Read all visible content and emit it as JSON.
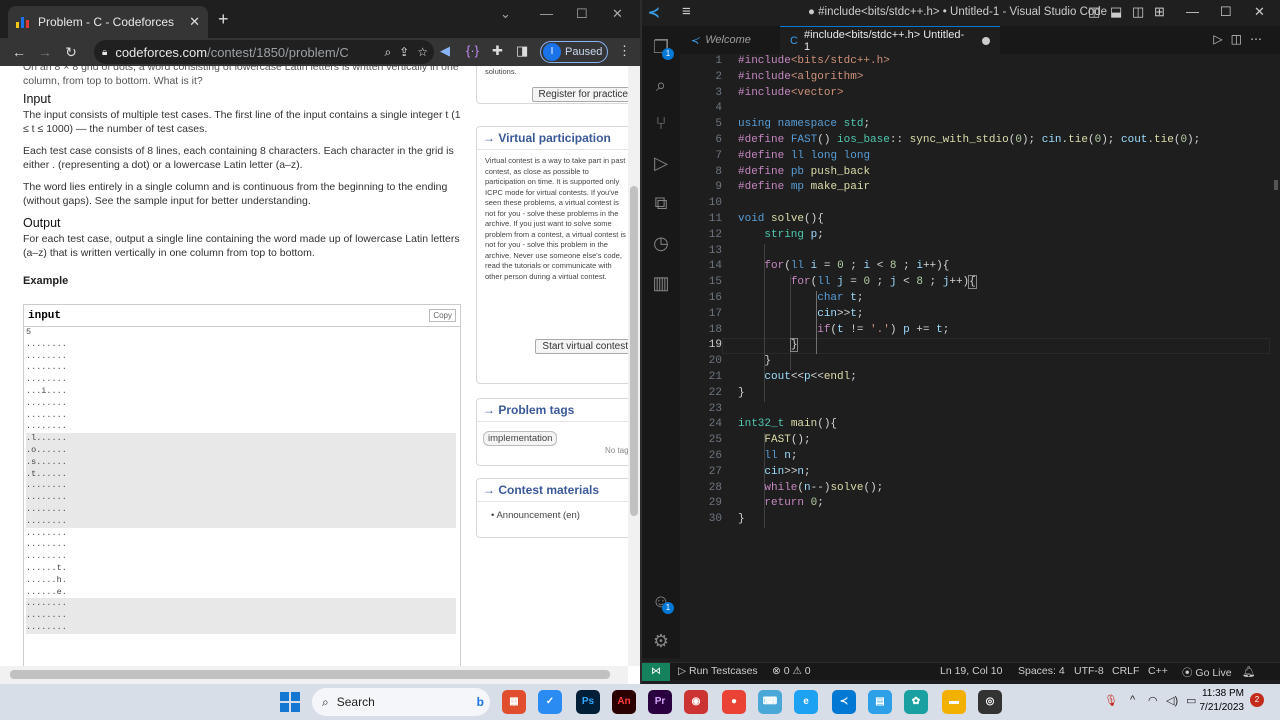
{
  "browser": {
    "tab_title": "Problem - C - Codeforces",
    "url_host": "codeforces.com",
    "url_path": "/contest/1850/problem/C",
    "profile_initial": "I",
    "profile_status": "Paused",
    "statement": {
      "intro_fragment": "On an 8 × 8 grid of dots, a word consisting of lowercase Latin letters is written vertically in one column, from top to bottom. What is it?",
      "input_heading": "Input",
      "input_p1": "The input consists of multiple test cases. The first line of the input contains a single integer t (1 ≤ t ≤ 1000) — the number of test cases.",
      "input_p2": "Each test case consists of 8 lines, each containing 8 characters. Each character in the grid is either . (representing a dot) or a lowercase Latin letter (a–z).",
      "input_p3": "The word lies entirely in a single column and is continuous from the beginning to the ending (without gaps). See the sample input for better understanding.",
      "output_heading": "Output",
      "output_p1": "For each test case, output a single line containing the word made up of lowercase Latin letters (a–z) that is written vertically in one column from top to bottom.",
      "example_label": "Example",
      "example_input_label": "input",
      "copy_label": "Copy"
    },
    "example_lines": [
      "5",
      "........",
      "........",
      "........",
      "........",
      "...i....",
      "........",
      "........",
      "........",
      ".l......",
      ".o......",
      ".s......",
      ".t......",
      "........",
      "........",
      "........",
      "........",
      "........",
      "........",
      "........",
      "......t.",
      "......h.",
      "......e.",
      "........",
      "........",
      "........"
    ],
    "sidebar": {
      "top_fragment": "solutions.",
      "register_button": "Register for practice",
      "virtual_title": "→ Virtual participation",
      "virtual_text": "Virtual contest is a way to take part in past contest, as close as possible to participation on time. It is supported only ICPC mode for virtual contests. If you've seen these problems, a virtual contest is not for you - solve these problems in the archive. If you just want to solve some problem from a contest, a virtual contest is not for you - solve this problem in the archive. Never use someone else's code, read the tutorials or communicate with other person during a virtual contest.",
      "virtual_button": "Start virtual contest",
      "tags_title": "→ Problem tags",
      "tag": "implementation",
      "no_tag": "No tag edit access",
      "materials_title": "→ Contest materials",
      "material": "Announcement (en)"
    }
  },
  "vscode": {
    "window_title": "● #include<bits/stdc++.h> • Untitled-1 - Visual Studio Code",
    "tabs": [
      {
        "label": "Welcome"
      },
      {
        "label": "#include<bits/stdc++.h>  Untitled-1"
      }
    ],
    "current_line": 19,
    "line_numbers": [
      "1",
      "2",
      "3",
      "4",
      "5",
      "6",
      "7",
      "8",
      "9",
      "10",
      "11",
      "12",
      "13",
      "14",
      "15",
      "16",
      "17",
      "18",
      "19",
      "20",
      "21",
      "22",
      "23",
      "24",
      "25",
      "26",
      "27",
      "28",
      "29",
      "30"
    ],
    "status": {
      "run": "Run Testcases",
      "problems": "⊗ 0 ⚠ 0",
      "cursor": "Ln 19, Col 10",
      "spaces": "Spaces: 4",
      "encoding": "UTF-8",
      "eol": "CRLF",
      "language": "C++",
      "golive": "Go Live"
    },
    "extension_badge": "1"
  },
  "taskbar": {
    "search_placeholder": "Search",
    "time": "11:38 PM",
    "date": "7/21/2023",
    "notifications": "2"
  },
  "colors": {
    "accent": "#0078d4",
    "cf_blue": "#3b5998",
    "remote": "#16825d"
  }
}
